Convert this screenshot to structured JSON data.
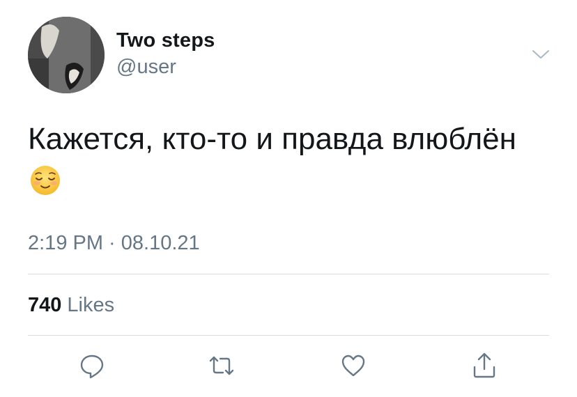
{
  "user": {
    "display_name": "Two steps",
    "handle": "@user"
  },
  "tweet": {
    "text": "Кажется, кто-то и правда влюблён",
    "emoji": "relieved-face-emoji",
    "timestamp": "2:19 PM · 08.10.21"
  },
  "stats": {
    "likes_count": "740",
    "likes_label": "Likes"
  },
  "actions": {
    "reply_icon": "reply-icon",
    "retweet_icon": "retweet-icon",
    "like_icon": "heart-icon",
    "share_icon": "share-icon"
  },
  "colors": {
    "text": "#14171a",
    "secondary": "#657786",
    "divider": "#d6dce0",
    "icon": "#657786"
  }
}
